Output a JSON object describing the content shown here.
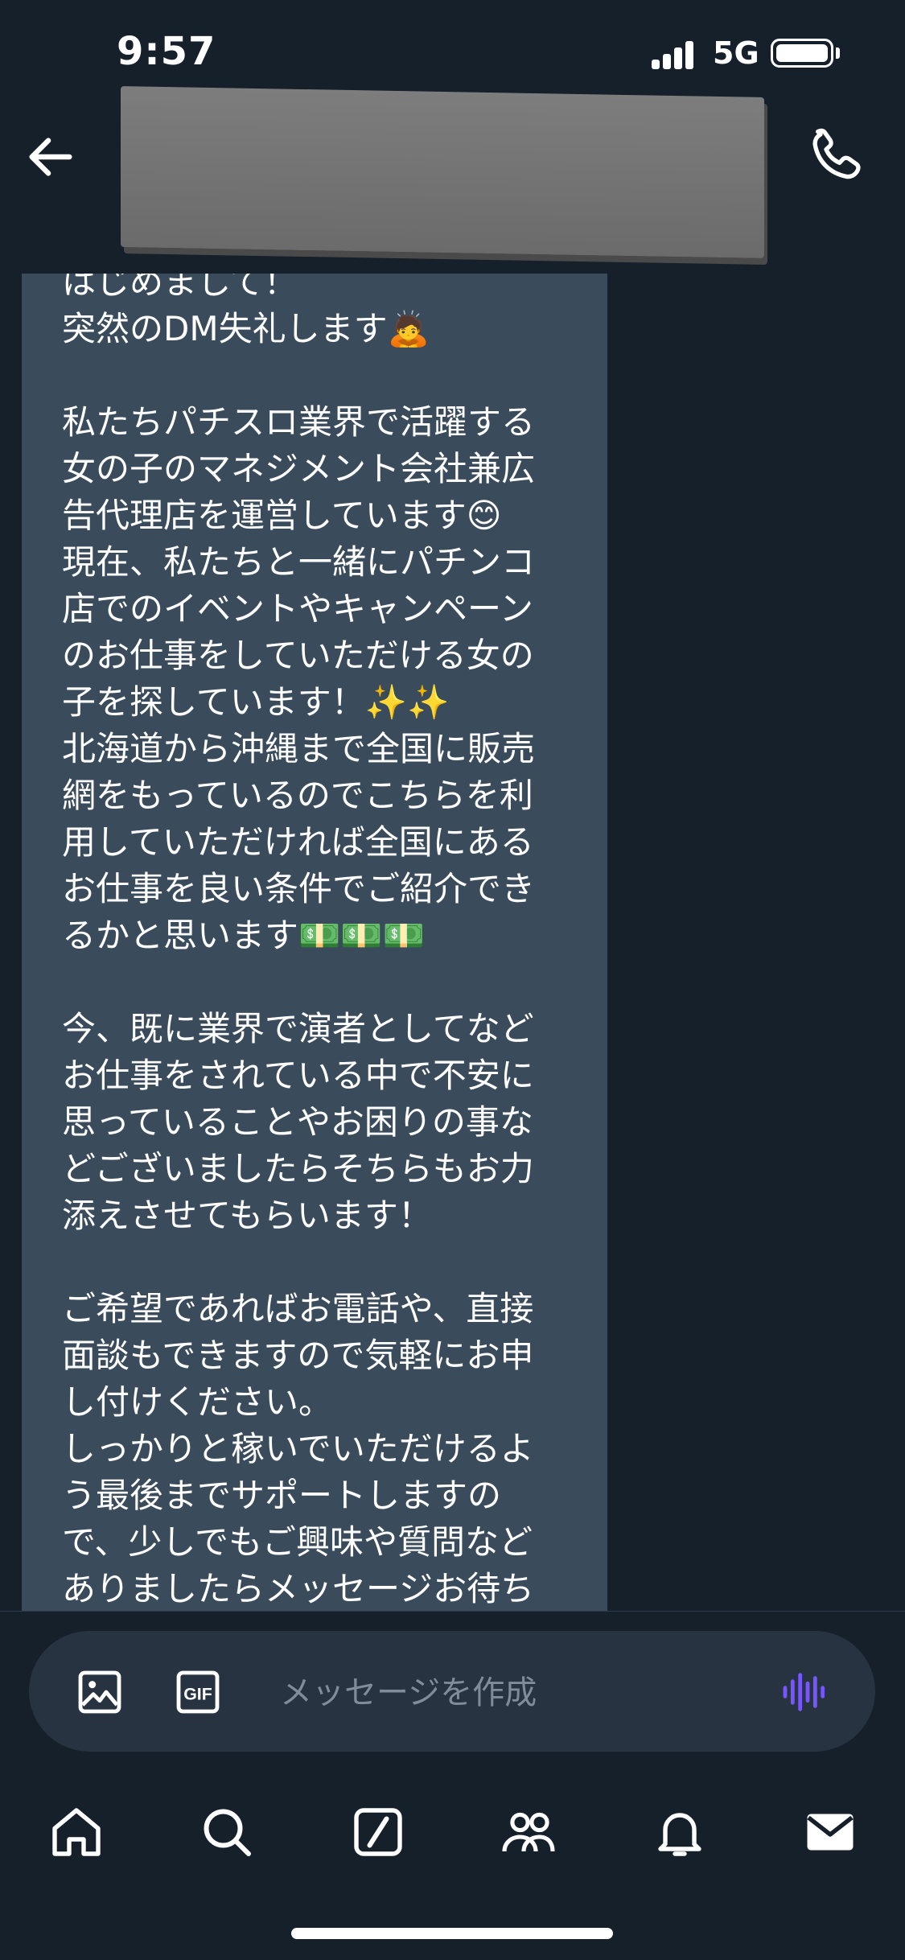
{
  "status_bar": {
    "time": "9:57",
    "network": "5G"
  },
  "header": {
    "back_icon": "arrow-left-icon",
    "call_icon": "phone-icon",
    "contact_name_redacted": true
  },
  "message": {
    "text": "はじめまして！\n突然のDM失礼します🙇\n\n私たちパチスロ業界で活躍する\n女の子のマネジメント会社兼広\n告代理店を運営しています😊\n現在、私たちと一緒にパチンコ\n店でのイベントやキャンペーン\nのお仕事をしていただける女の\n子を探しています！✨✨\n北海道から沖縄まで全国に販売\n網をもっているのでこちらを利\n用していただければ全国にある\nお仕事を良い条件でご紹介でき\nるかと思います💵💵💵\n\n今、既に業界で演者としてなど\nお仕事をされている中で不安に\n思っていることやお困りの事な\nどございましたらそちらもお力\n添えさせてもらいます！\n\nご希望であればお電話や、直接\n面談もできますので気軽にお申\nし付けください。\nしっかりと稼いでいただけるよ\nう最後までサポートしますの\nで、少しでもご興味や質問など\nありましたらメッセージお待ち"
  },
  "composer": {
    "placeholder": "メッセージを作成",
    "image_icon": "image-icon",
    "gif_icon": "gif-icon",
    "voice_icon": "voice-waveform-icon",
    "accent_color": "#7856ff"
  },
  "tabs": [
    {
      "name": "home",
      "icon": "home-icon"
    },
    {
      "name": "search",
      "icon": "search-icon"
    },
    {
      "name": "grok",
      "icon": "slash-box-icon"
    },
    {
      "name": "communities",
      "icon": "people-icon"
    },
    {
      "name": "notifications",
      "icon": "bell-icon"
    },
    {
      "name": "messages",
      "icon": "mail-icon"
    }
  ],
  "colors": {
    "background": "#15202b",
    "bubble": "#3a4b5c",
    "text": "#ffffff"
  }
}
